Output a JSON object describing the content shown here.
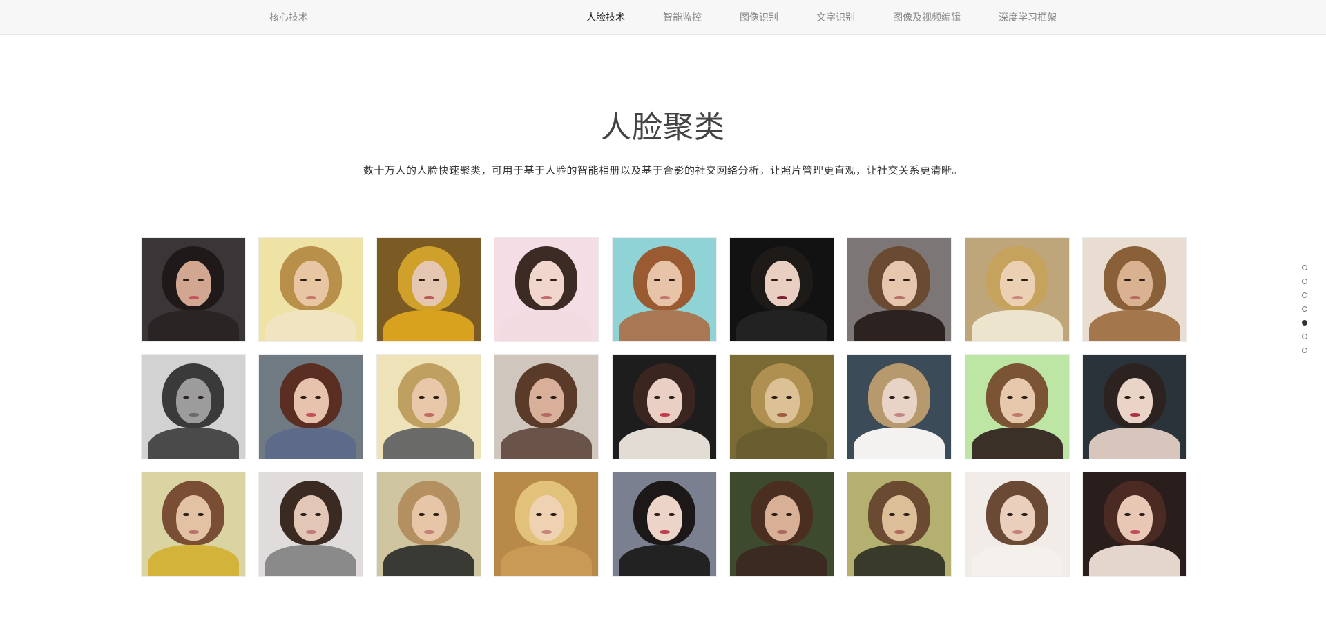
{
  "header": {
    "brand": "核心技术",
    "nav": [
      {
        "label": "人脸技术",
        "active": true
      },
      {
        "label": "智能监控",
        "active": false
      },
      {
        "label": "图像识别",
        "active": false
      },
      {
        "label": "文字识别",
        "active": false
      },
      {
        "label": "图像及视频编辑",
        "active": false
      },
      {
        "label": "深度学习框架",
        "active": false
      }
    ]
  },
  "section": {
    "title": "人脸聚类",
    "description": "数十万人的人脸快速聚类，可用于基于人脸的智能相册以及基于合影的社交网络分析。让照片管理更直观，让社交关系更清晰。"
  },
  "gallery": {
    "columns": 9,
    "photos": [
      {
        "bg": "#3a3536",
        "hair": "#1f1a19",
        "skin": "#d2a791",
        "body": "#2a2425",
        "lips": "#c4555c"
      },
      {
        "bg": "#efe2a5",
        "hair": "#b8904a",
        "skin": "#e9c6a3",
        "body": "#f1e4c0",
        "lips": "#c4786f"
      },
      {
        "bg": "#7b5a24",
        "hair": "#d0a12a",
        "skin": "#e5c7b1",
        "body": "#d8a21f",
        "lips": "#b85a55"
      },
      {
        "bg": "#f5dde5",
        "hair": "#3c2a25",
        "skin": "#f0d6cc",
        "body": "#f3dbe2",
        "lips": "#c26c70"
      },
      {
        "bg": "#8fd3d6",
        "hair": "#9a5a32",
        "skin": "#e7c3a8",
        "body": "#a87854",
        "lips": "#c07a70"
      },
      {
        "bg": "#121212",
        "hair": "#1e1a18",
        "skin": "#e8cfc2",
        "body": "#222222",
        "lips": "#7a2030"
      },
      {
        "bg": "#7c7676",
        "hair": "#6a4a30",
        "skin": "#e6c6ad",
        "body": "#2c2220",
        "lips": "#b4706a"
      },
      {
        "bg": "#bfa57a",
        "hair": "#c6a35c",
        "skin": "#ecd0b3",
        "body": "#ece4cc",
        "lips": "#c98a80"
      },
      {
        "bg": "#e8ddd0",
        "hair": "#8a6038",
        "skin": "#d9b292",
        "body": "#a4764c",
        "lips": "#b96a62"
      },
      {
        "bg": "#d2d2d2",
        "hair": "#3a3a3a",
        "skin": "#9c9c9c",
        "body": "#4a4a4a",
        "lips": "#6a6a6a"
      },
      {
        "bg": "#6f7a82",
        "hair": "#5a2e22",
        "skin": "#e7c2ad",
        "body": "#5d6a8a",
        "lips": "#c4505a"
      },
      {
        "bg": "#ede2b8",
        "hair": "#c0a060",
        "skin": "#e8c8a8",
        "body": "#6a6a68",
        "lips": "#c06c64"
      },
      {
        "bg": "#cfc7bd",
        "hair": "#5a3a28",
        "skin": "#d8b09a",
        "body": "#6a5348",
        "lips": "#b26a66"
      },
      {
        "bg": "#1d1d1d",
        "hair": "#3a2520",
        "skin": "#e9cfc4",
        "body": "#e2dcd4",
        "lips": "#c23c4a"
      },
      {
        "bg": "#7a6a34",
        "hair": "#b09050",
        "skin": "#dcc096",
        "body": "#6a5e30",
        "lips": "#9c5c44"
      },
      {
        "bg": "#3b4c58",
        "hair": "#b69a6e",
        "skin": "#e8d4c6",
        "body": "#f4f2f0",
        "lips": "#c2868a"
      },
      {
        "bg": "#bde6a4",
        "hair": "#7a5434",
        "skin": "#e6c8ac",
        "body": "#3a3028",
        "lips": "#c07a70"
      },
      {
        "bg": "#2a323a",
        "hair": "#2c2220",
        "skin": "#ead4c8",
        "body": "#d8c6bc",
        "lips": "#a83048"
      },
      {
        "bg": "#d9d4a2",
        "hair": "#7a4e34",
        "skin": "#e2c2a2",
        "body": "#d4b33a",
        "lips": "#b8706a"
      },
      {
        "bg": "#e0dcdc",
        "hair": "#3a2a22",
        "skin": "#e2c6b6",
        "body": "#8a8a8a",
        "lips": "#c07a78"
      },
      {
        "bg": "#cfc5a0",
        "hair": "#b49060",
        "skin": "#e6c6a6",
        "body": "#3a3a34",
        "lips": "#c28074"
      },
      {
        "bg": "#b88a4a",
        "hair": "#e2c27a",
        "skin": "#efd2b2",
        "body": "#c89a56",
        "lips": "#c8867a"
      },
      {
        "bg": "#7a8090",
        "hair": "#1c1818",
        "skin": "#ecd4c8",
        "body": "#222222",
        "lips": "#b8404e"
      },
      {
        "bg": "#3e4a2e",
        "hair": "#4a2e20",
        "skin": "#d8b096",
        "body": "#3a2a22",
        "lips": "#a86a60"
      },
      {
        "bg": "#b4b070",
        "hair": "#6a4a30",
        "skin": "#dcbe98",
        "body": "#3a3a2a",
        "lips": "#b06a5c"
      },
      {
        "bg": "#f2ece8",
        "hair": "#6a4a34",
        "skin": "#ead0bc",
        "body": "#f4f0ec",
        "lips": "#c2807a"
      },
      {
        "bg": "#2a1e1c",
        "hair": "#4a2a22",
        "skin": "#e8c8b4",
        "body": "#e4d6cc",
        "lips": "#c04a58"
      }
    ]
  },
  "page_nav": {
    "dots": 7,
    "active_index": 4
  }
}
